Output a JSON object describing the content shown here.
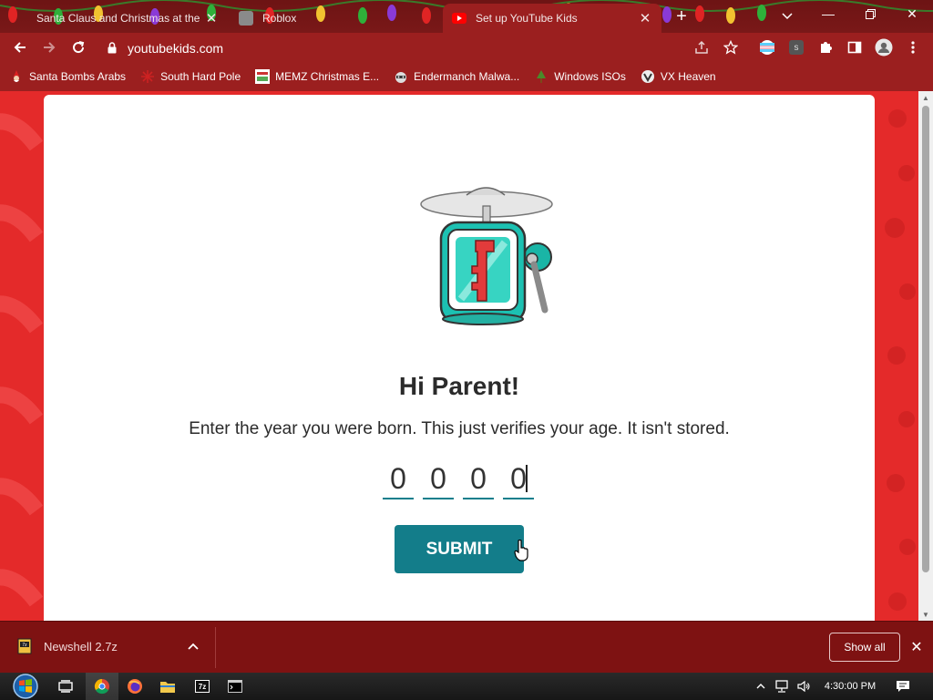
{
  "browser": {
    "tabs": [
      {
        "title": "Santa Claus and Christmas at the",
        "active": false,
        "favicon": "santa-icon"
      },
      {
        "title": "Roblox",
        "active": false,
        "favicon": "roblox-icon"
      },
      {
        "title": "Set up YouTube Kids",
        "active": true,
        "favicon": "youtube-icon"
      }
    ],
    "url": "youtubekids.com",
    "bookmarks": [
      {
        "label": "Santa Bombs Arabs",
        "icon": "santa-icon"
      },
      {
        "label": "South Hard Pole",
        "icon": "snowflake-icon"
      },
      {
        "label": "MEMZ Christmas E...",
        "icon": "memz-icon"
      },
      {
        "label": "Endermanch Malwa...",
        "icon": "raccoon-icon"
      },
      {
        "label": "Windows ISOs",
        "icon": "tree-icon"
      },
      {
        "label": "VX Heaven",
        "icon": "vx-icon"
      }
    ]
  },
  "page": {
    "heading": "Hi Parent!",
    "instruction": "Enter the year you were born. This just verifies your age. It isn't stored.",
    "digits": [
      "0",
      "0",
      "0",
      "0"
    ],
    "submit_label": "SUBMIT"
  },
  "downloads": {
    "file_name": "Newshell 2.7z",
    "show_all_label": "Show all"
  },
  "taskbar": {
    "clock": "4:30:00 PM",
    "apps": [
      "task-view-icon",
      "chrome-icon",
      "firefox-icon",
      "file-explorer-icon",
      "7zip-icon",
      "cmd-icon"
    ]
  },
  "colors": {
    "chrome_frame": "#7a1818",
    "chrome_toolbar": "#9b1f1f",
    "page_background": "#e42a2a",
    "accent_teal": "#137d8a",
    "shelf": "#7e1212"
  }
}
